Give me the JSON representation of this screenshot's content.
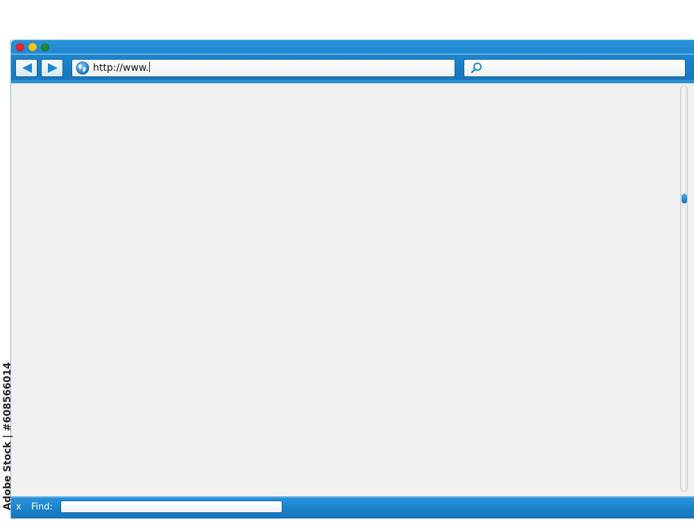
{
  "window": {
    "accent_color": "#1a7fc8",
    "traffic_lights": [
      "#e2262b",
      "#f6c91a",
      "#1e8a3a"
    ]
  },
  "toolbar": {
    "back_icon": "triangle-left-icon",
    "forward_icon": "triangle-right-icon",
    "address": {
      "icon": "globe-icon",
      "value": "http://www."
    },
    "search": {
      "icon": "search-icon",
      "value": ""
    }
  },
  "findbar": {
    "close_label": "x",
    "label": "Find:",
    "value": ""
  },
  "watermark": {
    "text": "Adobe Stock | #608566014"
  }
}
